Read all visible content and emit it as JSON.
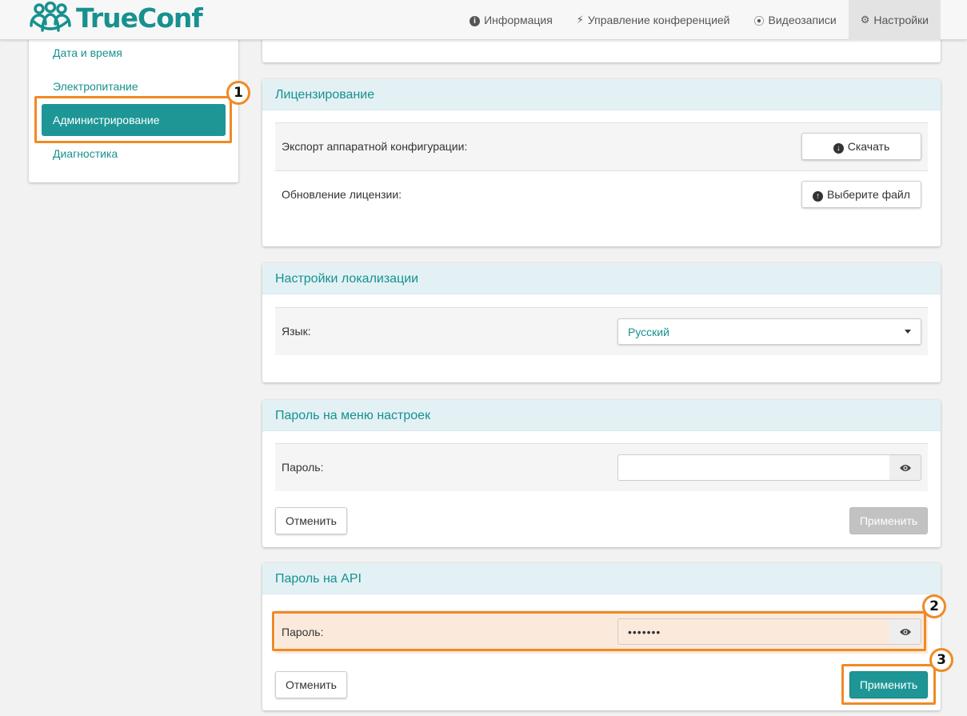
{
  "header": {
    "logo_text": "TrueConf",
    "nav": [
      {
        "label": "Информация",
        "icon": "info-circle-icon"
      },
      {
        "label": "Управление конференцией",
        "icon": "bolt-icon"
      },
      {
        "label": "Видеозаписи",
        "icon": "record-icon"
      },
      {
        "label": "Настройки",
        "icon": "gear-icon",
        "active": true
      }
    ]
  },
  "sidebar": {
    "items": [
      {
        "label": "Дата и время"
      },
      {
        "label": "Электропитание"
      },
      {
        "label": "Администрирование",
        "active": true
      },
      {
        "label": "Диагностика"
      }
    ]
  },
  "annotations": {
    "one": "1",
    "two": "2",
    "three": "3"
  },
  "licensing": {
    "title": "Лицензирование",
    "export_label": "Экспорт аппаратной конфигурации:",
    "download_button": "Скачать",
    "update_label": "Обновление лицензии:",
    "choose_file_button": "Выберите файл"
  },
  "localization": {
    "title": "Настройки локализации",
    "language_label": "Язык:",
    "language_value": "Русский"
  },
  "settings_password": {
    "title": "Пароль на меню настроек",
    "password_label": "Пароль:",
    "password_value": "",
    "cancel_button": "Отменить",
    "apply_button": "Применить"
  },
  "api_password": {
    "title": "Пароль на API",
    "password_label": "Пароль:",
    "password_value": "•••••••",
    "cancel_button": "Отменить",
    "apply_button": "Применить"
  },
  "colors": {
    "accent": "#1e9696",
    "highlight": "#f08a24"
  }
}
